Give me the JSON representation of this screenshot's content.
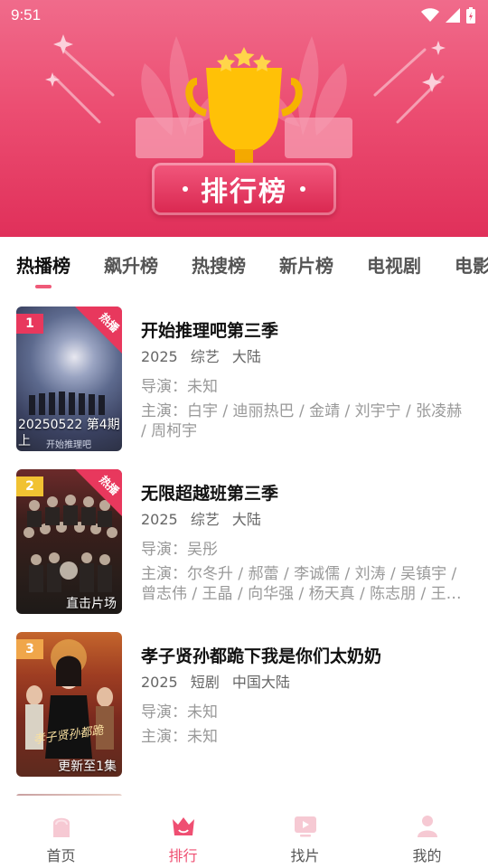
{
  "status_bar": {
    "time": "9:51"
  },
  "banner": {
    "title": "排行榜"
  },
  "tabs": [
    {
      "label": "热播榜",
      "active": true
    },
    {
      "label": "飙升榜",
      "active": false
    },
    {
      "label": "热搜榜",
      "active": false
    },
    {
      "label": "新片榜",
      "active": false
    },
    {
      "label": "电视剧",
      "active": false
    },
    {
      "label": "电影",
      "active": false
    }
  ],
  "items": [
    {
      "rank": "1",
      "rank_color": "#e8385d",
      "corner_tag": "热播",
      "poster_caption": "20250522 第4期上",
      "title": "开始推理吧第三季",
      "year": "2025",
      "genre": "综艺",
      "region": "大陆",
      "director": "导演：未知",
      "cast": "主演：白宇 / 迪丽热巴 / 金靖 / 刘宇宁 / 张凌赫 / 周柯宇"
    },
    {
      "rank": "2",
      "rank_color": "#f1c232",
      "corner_tag": "热播",
      "poster_caption": "直击片场",
      "title": "无限超越班第三季",
      "year": "2025",
      "genre": "综艺",
      "region": "大陆",
      "director": "导演：吴彤",
      "cast": "主演：尔冬升 / 郝蕾 / 李诚儒 / 刘涛 / 吴镇宇 / 曾志伟 / 王晶 / 向华强 / 杨天真 / 陈志朋 / 王…"
    },
    {
      "rank": "3",
      "rank_color": "#f0a64a",
      "corner_tag": "",
      "poster_caption": "更新至1集",
      "title": "孝子贤孙都跪下我是你们太奶奶",
      "year": "2025",
      "genre": "短剧",
      "region": "中国大陆",
      "director": "导演：未知",
      "cast": "主演：未知"
    }
  ],
  "bottom_nav": [
    {
      "label": "首页",
      "icon": "home-icon",
      "active": false
    },
    {
      "label": "排行",
      "icon": "crown-icon",
      "active": true
    },
    {
      "label": "找片",
      "icon": "video-icon",
      "active": false
    },
    {
      "label": "我的",
      "icon": "user-icon",
      "active": false
    }
  ],
  "colors": {
    "accent": "#ef4f72",
    "banner": "#ec4e72"
  }
}
